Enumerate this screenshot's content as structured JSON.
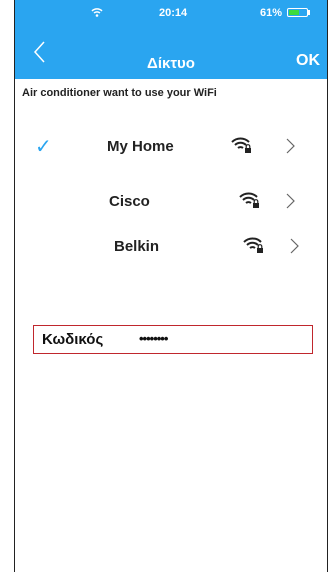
{
  "status_bar": {
    "time": "20:14",
    "battery": "61%",
    "battery_level": 0.61
  },
  "nav": {
    "title": "Δίκτυο",
    "ok_label": "OK"
  },
  "subtitle": "Air conditioner want to use your WiFi",
  "networks": [
    {
      "name": "My Home",
      "selected": true,
      "check": "✓"
    },
    {
      "name": "Cisco",
      "selected": false
    },
    {
      "name": "Belkin",
      "selected": false
    }
  ],
  "password": {
    "label": "Κωδικός",
    "value": "••••••••"
  },
  "colors": {
    "header": "#2aa5f0",
    "battery_fill": "#3ddb3d",
    "password_border": "#c0272d"
  }
}
